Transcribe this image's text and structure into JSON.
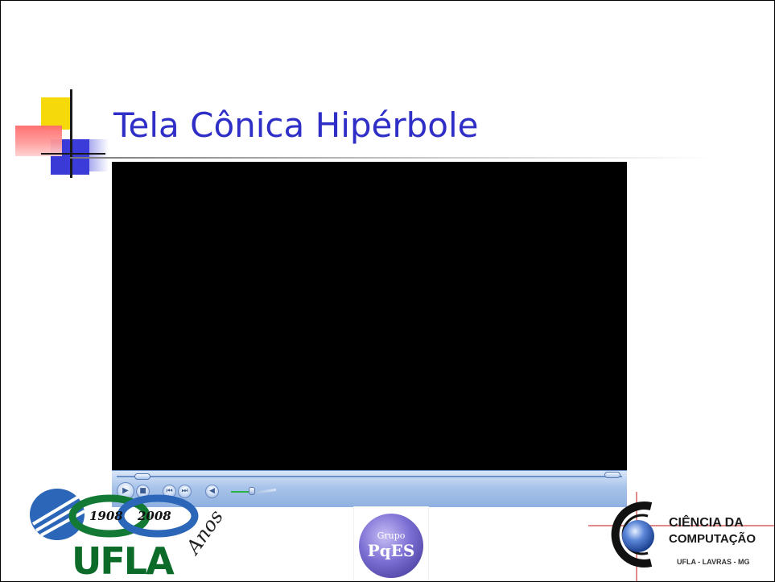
{
  "slide": {
    "title": "Tela Cônica Hipérbole",
    "title_color": "#2f2fc8"
  },
  "media_player": {
    "video_background": "#000000",
    "controls": [
      {
        "name": "play",
        "icon": "play-icon",
        "glyph": "▶"
      },
      {
        "name": "stop",
        "icon": "stop-icon",
        "glyph": "■"
      },
      {
        "name": "previous",
        "icon": "previous-icon",
        "glyph": "⏮"
      },
      {
        "name": "next",
        "icon": "next-icon",
        "glyph": "⏭"
      },
      {
        "name": "mute",
        "icon": "speaker-icon",
        "glyph": "◀"
      }
    ]
  },
  "logos": {
    "ufla": {
      "year_start": "1908",
      "year_end": "2008",
      "wordmark": "UFLA",
      "script": "Anos"
    },
    "pqes": {
      "line1": "Grupo",
      "line2": "PqES"
    },
    "ciencia_computacao": {
      "line1": "CIÊNCIA DA",
      "line2": "COMPUTAÇÃO",
      "line3": "UFLA - LAVRAS - MG"
    }
  }
}
